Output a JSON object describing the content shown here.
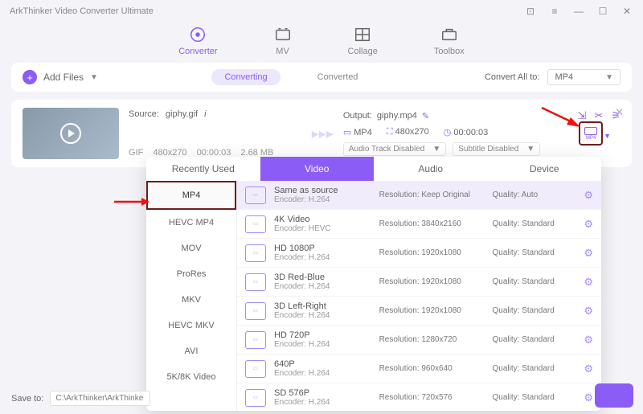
{
  "titlebar": {
    "title": "ArkThinker Video Converter Ultimate"
  },
  "top_tabs": [
    {
      "label": "Converter",
      "active": true
    },
    {
      "label": "MV"
    },
    {
      "label": "Collage"
    },
    {
      "label": "Toolbox"
    }
  ],
  "toolbar": {
    "add_files": "Add Files",
    "converting": "Converting",
    "converted": "Converted",
    "convert_all_label": "Convert All to:",
    "convert_all_value": "MP4"
  },
  "file": {
    "source_label": "Source:",
    "source_name": "giphy.gif",
    "source_fmt": "GIF",
    "source_dim": "480x270",
    "source_dur": "00:00:03",
    "source_size": "2.68 MB",
    "output_label": "Output:",
    "output_name": "giphy.mp4",
    "output_fmt": "MP4",
    "output_dim": "480x270",
    "output_dur": "00:00:03",
    "audio_track": "Audio Track Disabled",
    "subtitle": "Subtitle Disabled"
  },
  "dropdown": {
    "tabs": [
      "Recently Used",
      "Video",
      "Audio",
      "Device"
    ],
    "active_tab": "Video",
    "left": [
      "MP4",
      "HEVC MP4",
      "MOV",
      "ProRes",
      "MKV",
      "HEVC MKV",
      "AVI",
      "5K/8K Video"
    ],
    "left_selected": "MP4",
    "presets": [
      {
        "name": "Same as source",
        "enc": "Encoder: H.264",
        "res": "Resolution: Keep Original",
        "qual": "Quality: Auto",
        "sel": true
      },
      {
        "name": "4K Video",
        "enc": "Encoder: HEVC",
        "res": "Resolution: 3840x2160",
        "qual": "Quality: Standard"
      },
      {
        "name": "HD 1080P",
        "enc": "Encoder: H.264",
        "res": "Resolution: 1920x1080",
        "qual": "Quality: Standard"
      },
      {
        "name": "3D Red-Blue",
        "enc": "Encoder: H.264",
        "res": "Resolution: 1920x1080",
        "qual": "Quality: Standard"
      },
      {
        "name": "3D Left-Right",
        "enc": "Encoder: H.264",
        "res": "Resolution: 1920x1080",
        "qual": "Quality: Standard"
      },
      {
        "name": "HD 720P",
        "enc": "Encoder: H.264",
        "res": "Resolution: 1280x720",
        "qual": "Quality: Standard"
      },
      {
        "name": "640P",
        "enc": "Encoder: H.264",
        "res": "Resolution: 960x640",
        "qual": "Quality: Standard"
      },
      {
        "name": "SD 576P",
        "enc": "Encoder: H.264",
        "res": "Resolution: 720x576",
        "qual": "Quality: Standard"
      }
    ]
  },
  "save_to": {
    "label": "Save to:",
    "path": "C:\\ArkThinker\\ArkThinke"
  }
}
